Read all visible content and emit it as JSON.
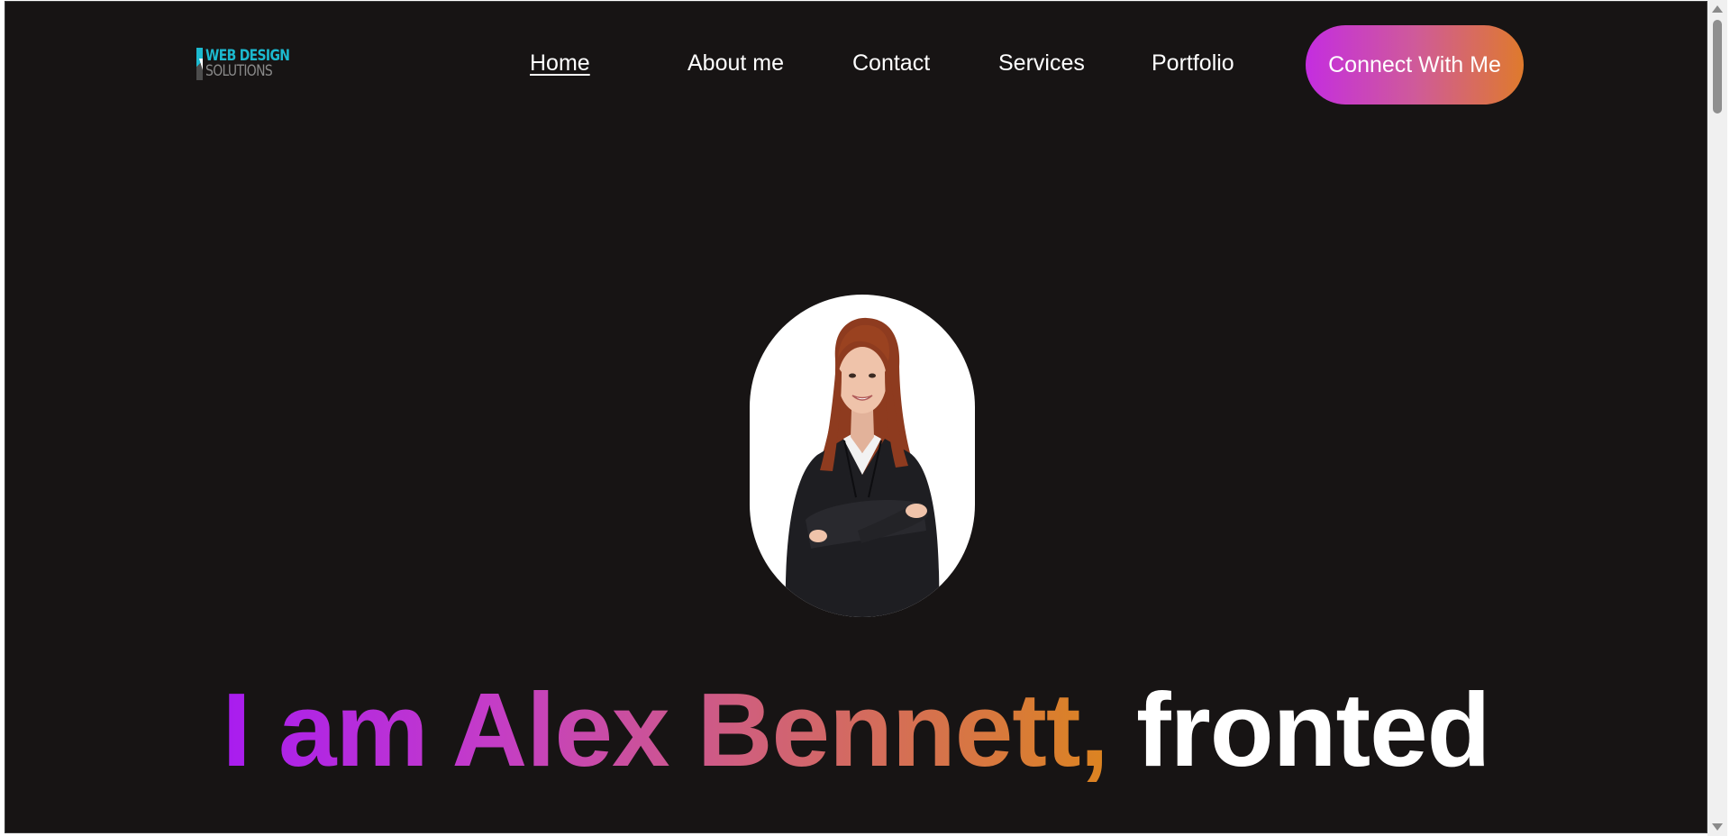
{
  "logo": {
    "line1": "WEB DESIGN",
    "line2": "SOLUTIONS",
    "colors": {
      "primary": "#1cb9cf",
      "secondary": "#8a8a8a"
    }
  },
  "nav": {
    "items": [
      {
        "label": "Home",
        "active": true
      },
      {
        "label": "About me",
        "active": false
      },
      {
        "label": "Contact",
        "active": false
      },
      {
        "label": "Services",
        "active": false
      },
      {
        "label": "Portfolio",
        "active": false
      }
    ],
    "cta_label": "Connect With Me"
  },
  "hero": {
    "headline_gradient": "I am Alex Bennett,",
    "headline_plain": "fronted",
    "portrait_icon": "profile-photo"
  },
  "colors": {
    "background": "#171414",
    "text": "#ffffff",
    "gradient_start": "#a81cf0",
    "gradient_end": "#dc8420"
  }
}
